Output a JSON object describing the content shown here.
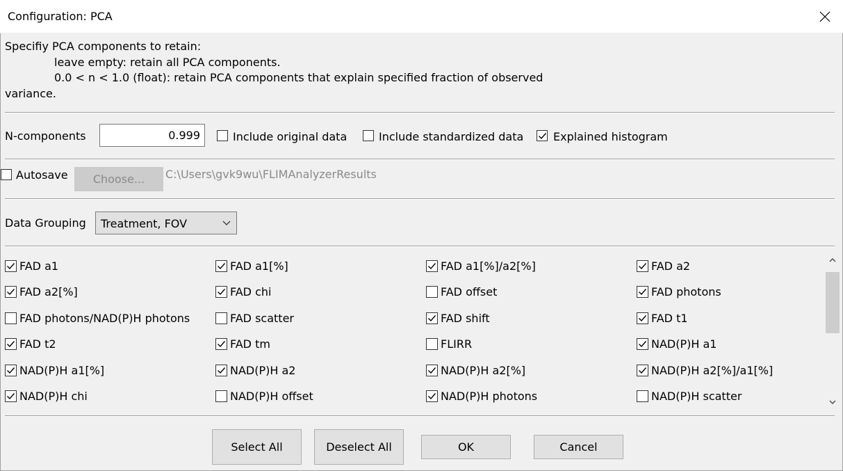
{
  "window": {
    "title": "Configuration: PCA"
  },
  "description": {
    "line1": "Specifiy PCA components to retain:",
    "line2": "leave empty:   retain all PCA components.",
    "line3": "0.0 < n < 1.0 (float):   retain PCA components that explain specified fraction of observed",
    "line4": "variance."
  },
  "ncomponents": {
    "label": "N-components",
    "value": "0.999",
    "include_original": {
      "label": "Include original data",
      "checked": false
    },
    "include_standardized": {
      "label": "Include standardized data",
      "checked": false
    },
    "explained_histogram": {
      "label": "Explained histogram",
      "checked": true
    }
  },
  "autosave": {
    "label": "Autosave",
    "checked": false,
    "choose_label": "Choose...",
    "path": "C:\\Users\\gvk9wu\\FLIMAnalyzerResults"
  },
  "grouping": {
    "label": "Data Grouping",
    "selected": "Treatment, FOV"
  },
  "features": [
    {
      "label": "FAD a1",
      "checked": true
    },
    {
      "label": "FAD a1[%]",
      "checked": true
    },
    {
      "label": "FAD a1[%]/a2[%]",
      "checked": true
    },
    {
      "label": "FAD a2",
      "checked": true
    },
    {
      "label": "FAD a2[%]",
      "checked": true
    },
    {
      "label": "FAD chi",
      "checked": true
    },
    {
      "label": "FAD offset",
      "checked": false
    },
    {
      "label": "FAD photons",
      "checked": true
    },
    {
      "label": "FAD photons/NAD(P)H photons",
      "checked": false
    },
    {
      "label": "FAD scatter",
      "checked": false
    },
    {
      "label": "FAD shift",
      "checked": true
    },
    {
      "label": "FAD t1",
      "checked": true
    },
    {
      "label": "FAD t2",
      "checked": true
    },
    {
      "label": "FAD tm",
      "checked": true
    },
    {
      "label": "FLIRR",
      "checked": false
    },
    {
      "label": "NAD(P)H a1",
      "checked": true
    },
    {
      "label": "NAD(P)H a1[%]",
      "checked": true
    },
    {
      "label": "NAD(P)H a2",
      "checked": true
    },
    {
      "label": "NAD(P)H a2[%]",
      "checked": true
    },
    {
      "label": "NAD(P)H a2[%]/a1[%]",
      "checked": true
    },
    {
      "label": "NAD(P)H chi",
      "checked": true
    },
    {
      "label": "NAD(P)H offset",
      "checked": false
    },
    {
      "label": "NAD(P)H photons",
      "checked": true
    },
    {
      "label": "NAD(P)H scatter",
      "checked": false
    }
  ],
  "buttons": {
    "select_all": "Select All",
    "deselect_all": "Deselect All",
    "ok": "OK",
    "cancel": "Cancel"
  }
}
